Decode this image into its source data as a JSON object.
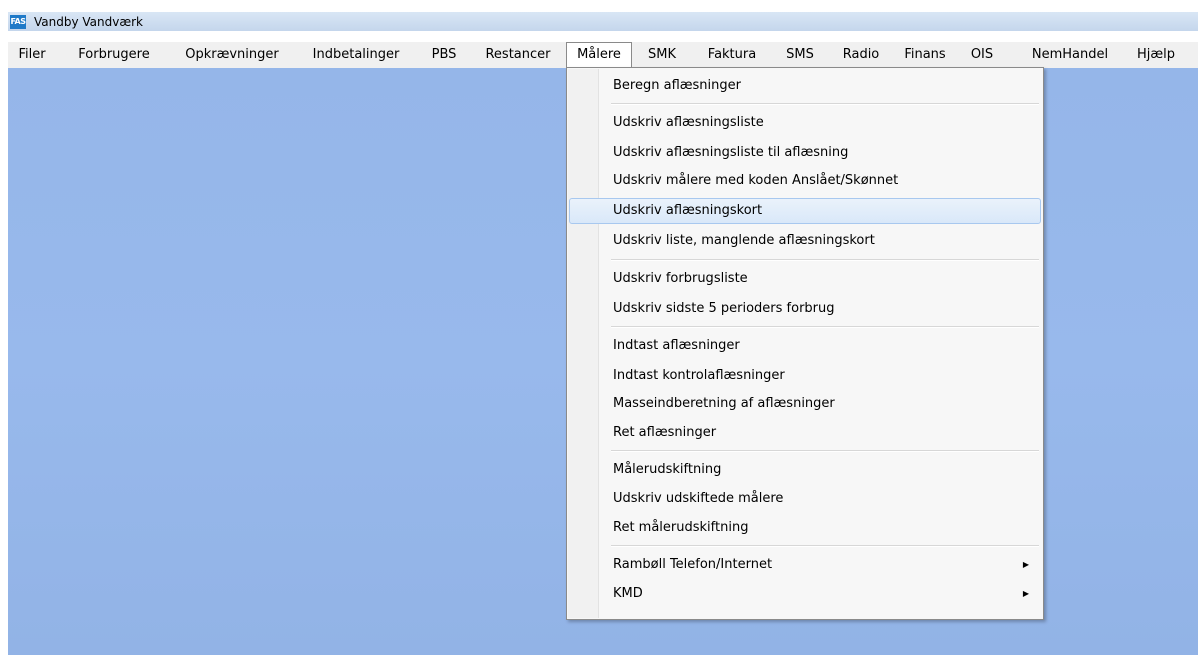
{
  "window": {
    "icon_text": "FAS",
    "title": "Vandby Vandværk"
  },
  "menubar": {
    "items": [
      {
        "label": "Filer"
      },
      {
        "label": "Forbrugere"
      },
      {
        "label": "Opkrævninger"
      },
      {
        "label": "Indbetalinger"
      },
      {
        "label": "PBS"
      },
      {
        "label": "Restancer"
      },
      {
        "label": "Målere"
      },
      {
        "label": "SMK"
      },
      {
        "label": "Faktura"
      },
      {
        "label": "SMS"
      },
      {
        "label": "Radio"
      },
      {
        "label": "Finans"
      },
      {
        "label": "OIS"
      },
      {
        "label": "NemHandel"
      },
      {
        "label": "Hjælp"
      }
    ],
    "open_menu": "Målere"
  },
  "dropdown": {
    "items": [
      {
        "label": "Beregn aflæsninger"
      },
      {
        "label": "Udskriv aflæsningsliste"
      },
      {
        "label": "Udskriv aflæsningsliste til aflæsning"
      },
      {
        "label": "Udskriv målere med koden Anslået/Skønnet"
      },
      {
        "label": "Udskriv aflæsningskort",
        "highlighted": true
      },
      {
        "label": "Udskriv liste, manglende aflæsningskort"
      },
      {
        "label": "Udskriv forbrugsliste"
      },
      {
        "label": "Udskriv sidste 5 perioders forbrug"
      },
      {
        "label": "Indtast aflæsninger"
      },
      {
        "label": "Indtast kontrolaflæsninger"
      },
      {
        "label": "Masseindberetning af aflæsninger"
      },
      {
        "label": "Ret aflæsninger"
      },
      {
        "label": "Målerudskiftning"
      },
      {
        "label": "Udskriv udskiftede målere"
      },
      {
        "label": "Ret målerudskiftning"
      },
      {
        "label": "Rambøll Telefon/Internet",
        "submenu": true
      },
      {
        "label": "KMD",
        "submenu": true
      }
    ],
    "submenu_arrow": "▶"
  },
  "colors": {
    "desktop": "#95b6e9",
    "menubar": "#f0f0f0",
    "highlight": "#d9e8f9"
  }
}
